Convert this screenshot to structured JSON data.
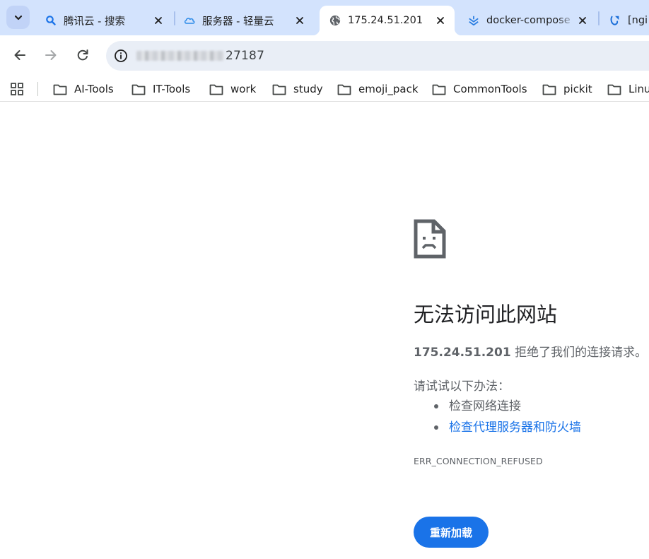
{
  "tabs": [
    {
      "title": "腾讯云 - 搜索",
      "icon": "search-icon",
      "active": false
    },
    {
      "title": "服务器 - 轻量云",
      "icon": "cloud-icon",
      "active": false
    },
    {
      "title": "175.24.51.201",
      "icon": "globe-icon",
      "active": true
    },
    {
      "title": "docker-compose",
      "icon": "docker-doc-icon",
      "active": false
    },
    {
      "title": "[ngi",
      "icon": "nginx-icon",
      "active": false
    }
  ],
  "toolbar": {
    "url_suffix": "27187"
  },
  "bookmarks": {
    "items": [
      "AI-Tools",
      "IT-Tools",
      "work",
      "study",
      "emoji_pack",
      "CommonTools",
      "pickit",
      "Linu"
    ]
  },
  "error": {
    "title": "无法访问此网站",
    "host": "175.24.51.201",
    "summary_suffix": " 拒绝了我们的连接请求。",
    "try_label": "请试试以下办法：",
    "suggestions": [
      "检查网络连接",
      "检查代理服务器和防火墙"
    ],
    "code": "ERR_CONNECTION_REFUSED",
    "reload_label": "重新加载"
  },
  "colors": {
    "tabstrip": "#d3e3fd",
    "accent": "#1a73e8",
    "omnibox": "#e9eef6"
  }
}
